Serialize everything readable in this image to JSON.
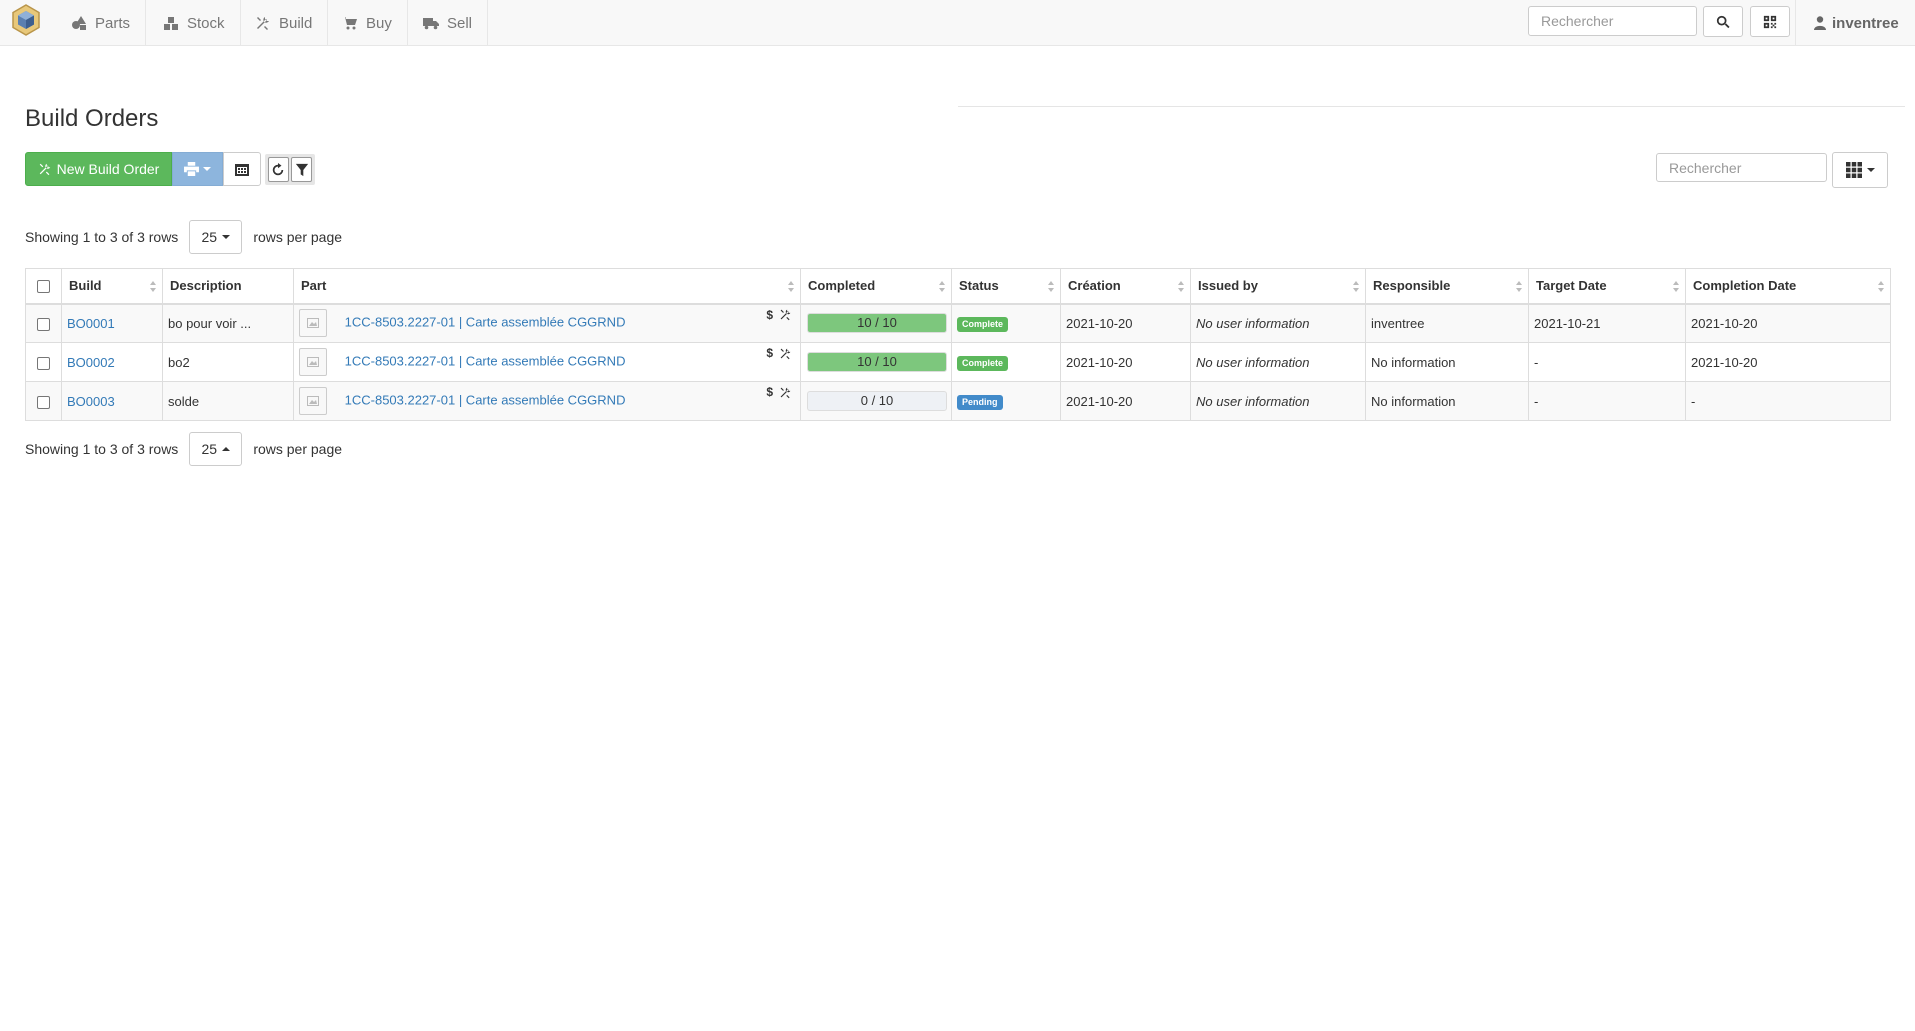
{
  "nav": {
    "items": [
      {
        "label": "Parts",
        "icon": "shapes-icon"
      },
      {
        "label": "Stock",
        "icon": "boxes-icon"
      },
      {
        "label": "Build",
        "icon": "tools-icon"
      },
      {
        "label": "Buy",
        "icon": "shopping-cart-icon"
      },
      {
        "label": "Sell",
        "icon": "truck-icon"
      }
    ],
    "search_placeholder": "Rechercher",
    "user": "inventree"
  },
  "page": {
    "title": "Build Orders",
    "new_button_label": "New Build Order",
    "table_search_placeholder": "Rechercher"
  },
  "pagination": {
    "info": "Showing 1 to 3 of 3 rows",
    "page_size": "25",
    "rows_per_page": "rows per page"
  },
  "table": {
    "columns": [
      "Build",
      "Description",
      "Part",
      "Completed",
      "Status",
      "Création",
      "Issued by",
      "Responsible",
      "Target Date",
      "Completion Date"
    ],
    "part_icon_dollar": "$",
    "rows": [
      {
        "build": "BO0001",
        "description": "bo pour voir ...",
        "part": "1CC-8503.2227-01 | Carte assemblée CGGRND",
        "completed_text": "10 / 10",
        "completed_fraction": 1.0,
        "status": "Complete",
        "status_color": "#5cb85c",
        "creation": "2021-10-20",
        "issued_by": "No user information",
        "responsible": "inventree",
        "target_date": "2021-10-21",
        "completion_date": "2021-10-20"
      },
      {
        "build": "BO0002",
        "description": "bo2",
        "part": "1CC-8503.2227-01 | Carte assemblée CGGRND",
        "completed_text": "10 / 10",
        "completed_fraction": 1.0,
        "status": "Complete",
        "status_color": "#5cb85c",
        "creation": "2021-10-20",
        "issued_by": "No user information",
        "responsible": "No information",
        "target_date": "-",
        "completion_date": "2021-10-20"
      },
      {
        "build": "BO0003",
        "description": "solde",
        "part": "1CC-8503.2227-01 | Carte assemblée CGGRND",
        "completed_text": "0 / 10",
        "completed_fraction": 0.0,
        "status": "Pending",
        "status_color": "#428bca",
        "creation": "2021-10-20",
        "issued_by": "No user information",
        "responsible": "No information",
        "target_date": "-",
        "completion_date": "-"
      }
    ]
  }
}
